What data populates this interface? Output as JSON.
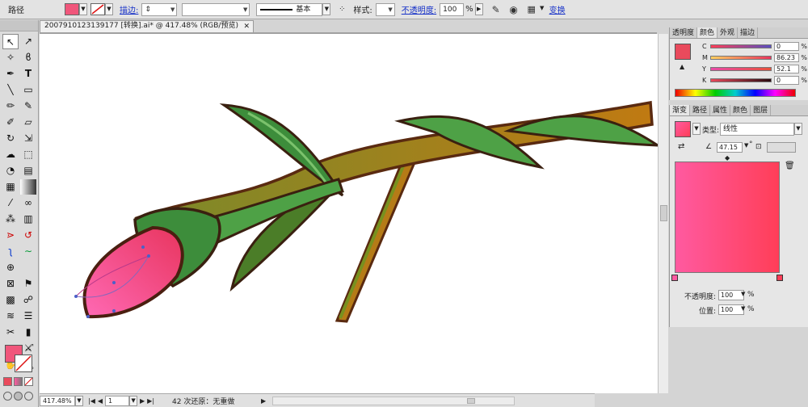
{
  "control_bar": {
    "object_type": "路径",
    "fill_color": "#f0567b",
    "stroke_label": "描边:",
    "stroke_profile": "基本",
    "style_label": "样式:",
    "opacity_label": "不透明度:",
    "opacity_value": "100",
    "opacity_unit": "%",
    "transform_link": "变换"
  },
  "document": {
    "tab_title": "2007910123139177  [转换].ai* @ 417.48% (RGB/预览)",
    "close_symbol": "✕"
  },
  "status_bar": {
    "zoom": "417.48%",
    "page": "1",
    "undo_info": "42 次还原：无重做"
  },
  "color_panel": {
    "tabs": [
      "透明度",
      "颜色",
      "外观",
      "描边"
    ],
    "active_tab": "颜色",
    "channels": [
      {
        "label": "C",
        "value": "0",
        "unit": "%"
      },
      {
        "label": "M",
        "value": "86.23",
        "unit": "%"
      },
      {
        "label": "Y",
        "value": "52.1",
        "unit": "%"
      },
      {
        "label": "K",
        "value": "0",
        "unit": "%"
      }
    ],
    "current_color": "#e94a5c"
  },
  "gradient_panel": {
    "tabs": [
      "渐变",
      "路径",
      "属性",
      "颜色",
      "图层"
    ],
    "active_tab": "渐变",
    "type_label": "类型:",
    "type_value": "线性",
    "angle_value": "47.15",
    "angle_unit": "°",
    "start_color": "#ff5aa0",
    "end_color": "#ff3e58",
    "opacity_label": "不透明度:",
    "opacity_value": "100",
    "location_label": "位置:",
    "location_value": "100",
    "unit": "%"
  },
  "tools": [
    "selection",
    "direct-selection",
    "magic-wand",
    "lasso",
    "pen",
    "type",
    "line",
    "rectangle",
    "paintbrush",
    "pencil",
    "blob-brush",
    "eraser",
    "rotate",
    "scale",
    "warp",
    "free-transform",
    "shape-builder",
    "perspective-grid",
    "mesh",
    "gradient",
    "eyedropper",
    "blend",
    "symbol-sprayer",
    "column-graph",
    "artboard",
    "slice",
    "hand",
    "zoom"
  ]
}
